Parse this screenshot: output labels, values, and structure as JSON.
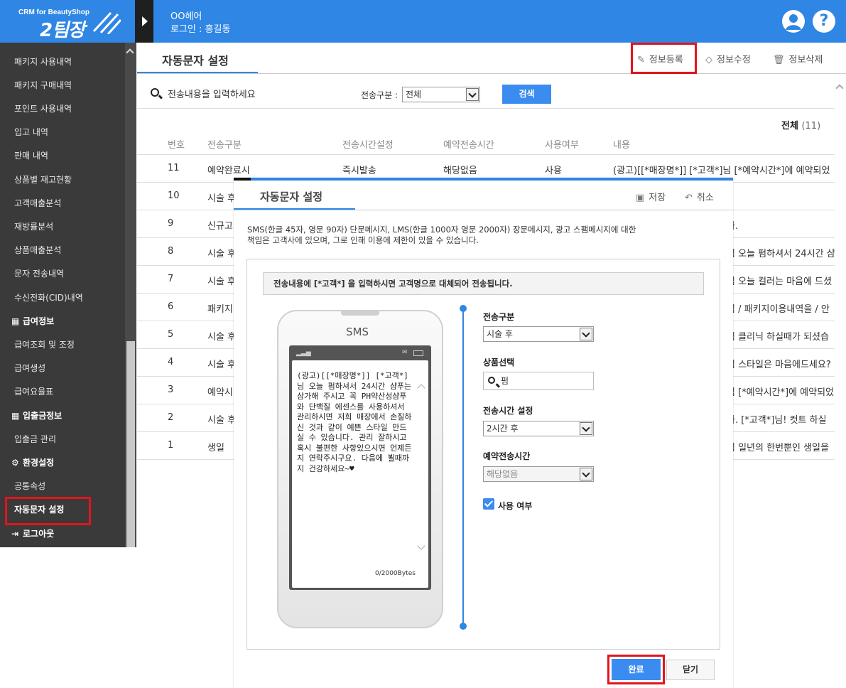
{
  "header": {
    "logo_sub": "CRM for BeautyShop",
    "logo_main": "2팀장",
    "shop_name": "OO헤어",
    "login_label": "로그인 : 홍길동",
    "user_icon": "user-icon",
    "help_icon": "help-icon",
    "help_glyph": "?"
  },
  "sidebar": {
    "items": [
      {
        "label": "패키지 사용내역"
      },
      {
        "label": "패키지 구매내역"
      },
      {
        "label": "포인트 사용내역"
      },
      {
        "label": "입고 내역"
      },
      {
        "label": "판매 내역"
      },
      {
        "label": "상품별 재고현황"
      },
      {
        "label": "고객매출분석"
      },
      {
        "label": "재방률분석"
      },
      {
        "label": "상품매출분석"
      },
      {
        "label": "문자 전송내역"
      },
      {
        "label": "수신전화(CID)내역"
      }
    ],
    "group_pay": "급여정보",
    "pay_items": [
      {
        "label": "급여조회 및 조정"
      },
      {
        "label": "급여생성"
      },
      {
        "label": "급여요율표"
      }
    ],
    "group_cash": "입출금정보",
    "cash_items": [
      {
        "label": "입출금 관리"
      }
    ],
    "group_settings": "환경설정",
    "settings_items": [
      {
        "label": "공통속성"
      },
      {
        "label": "자동문자 설정"
      }
    ],
    "logout": "로그아웃"
  },
  "main": {
    "title": "자동문자 설정",
    "toolbar": {
      "register": "정보등록",
      "edit": "정보수정",
      "delete": "정보삭제"
    },
    "search": {
      "placeholder": "전송내용을 입력하세요",
      "type_label": "전송구분 :",
      "type_value": "전체",
      "button": "검색"
    },
    "total_label": "전체",
    "total_count": "(11)",
    "columns": [
      "번호",
      "전송구분",
      "전송시간설정",
      "예약전송시간",
      "사용여부",
      "내용"
    ],
    "rows": [
      {
        "no": "11",
        "type": "예약완료시",
        "time": "즉시발송",
        "reserve": "해당없음",
        "use": "사용",
        "content": "(광고)[[*매장명*]] [*고객*]님 [*예약시간*]에 예약되었"
      },
      {
        "no": "10",
        "type": "시술 후",
        "time": "",
        "reserve": "",
        "use": "",
        "content": ""
      },
      {
        "no": "9",
        "type": "신규고",
        "time": "",
        "reserve": "",
        "use": "",
        "content": "다."
      },
      {
        "no": "8",
        "type": "시술 후",
        "time": "",
        "reserve": "",
        "use": "",
        "content": "님 오늘 펌하셔서 24시간 샴"
      },
      {
        "no": "7",
        "type": "시술 후",
        "time": "",
        "reserve": "",
        "use": "",
        "content": "님 오늘 컬러는 마음에 드셨"
      },
      {
        "no": "6",
        "type": "패키지",
        "time": "",
        "reserve": "",
        "use": "",
        "content": "님 / 패키지이용내역을 / 안"
      },
      {
        "no": "5",
        "type": "시술 후",
        "time": "",
        "reserve": "",
        "use": "",
        "content": "님 클리닉 하실때가 되셨습"
      },
      {
        "no": "4",
        "type": "시술 후",
        "time": "",
        "reserve": "",
        "use": "",
        "content": "님 스타일은 마음에드세요?"
      },
      {
        "no": "3",
        "type": "예약시",
        "time": "",
        "reserve": "",
        "use": "",
        "content": "님 [*예약시간*]에 예약되었"
      },
      {
        "no": "2",
        "type": "시술 후",
        "time": "",
        "reserve": "",
        "use": "",
        "content": "다. [*고객*]님! 컷트 하실"
      },
      {
        "no": "1",
        "type": "생일",
        "time": "",
        "reserve": "",
        "use": "",
        "content": "님 일년의 한번뿐인 생일을"
      }
    ]
  },
  "modal": {
    "title": "자동문자 설정",
    "save": "저장",
    "cancel": "취소",
    "notice_line1": "SMS(한글 45자, 영문 90자) 단문메시지, LMS(한글 1000자 영문 2000자) 장문메시지, 광고 스팸메시지에 대한",
    "notice_line2": "책임은 고객사에 있으며, 그로 인해 이용에 제한이 있을 수 있습니다.",
    "info": "전송내용에 [*고객*] 을 입력하시면 고객명으로 대체되어 전송됩니다.",
    "phone_label": "SMS",
    "message": "(광고)[[*매장명*]] [*고객*]님 오늘 펌하셔서 24시간 샴푸는 삼가해 주시고 꼭 PH약산성샴푸와 단백질 에센스를 사용하셔서 관리하시면 저희 매장에서 손질하신 것과 같이 예쁜 스타일 만드실 수 있습니다. 관리 잘하시고 혹시 불편한 사항있으시면 언제든지 연락주시구요. 다음에 뵐때까지 건강하세요~♥",
    "bytes": "0/2000Bytes",
    "fields": {
      "type_label": "전송구분",
      "type_value": "시술 후",
      "product_label": "상품선택",
      "product_value": "펌",
      "time_label": "전송시간 설정",
      "time_value": "2시간 후",
      "reserve_label": "예약전송시간",
      "reserve_value": "해당없음",
      "use_label": "사용 여부"
    },
    "done": "완료",
    "close": "닫기"
  },
  "colors": {
    "brand": "#2f86e4",
    "highlight": "#e3141b",
    "sidebar": "#3a3a3a"
  }
}
